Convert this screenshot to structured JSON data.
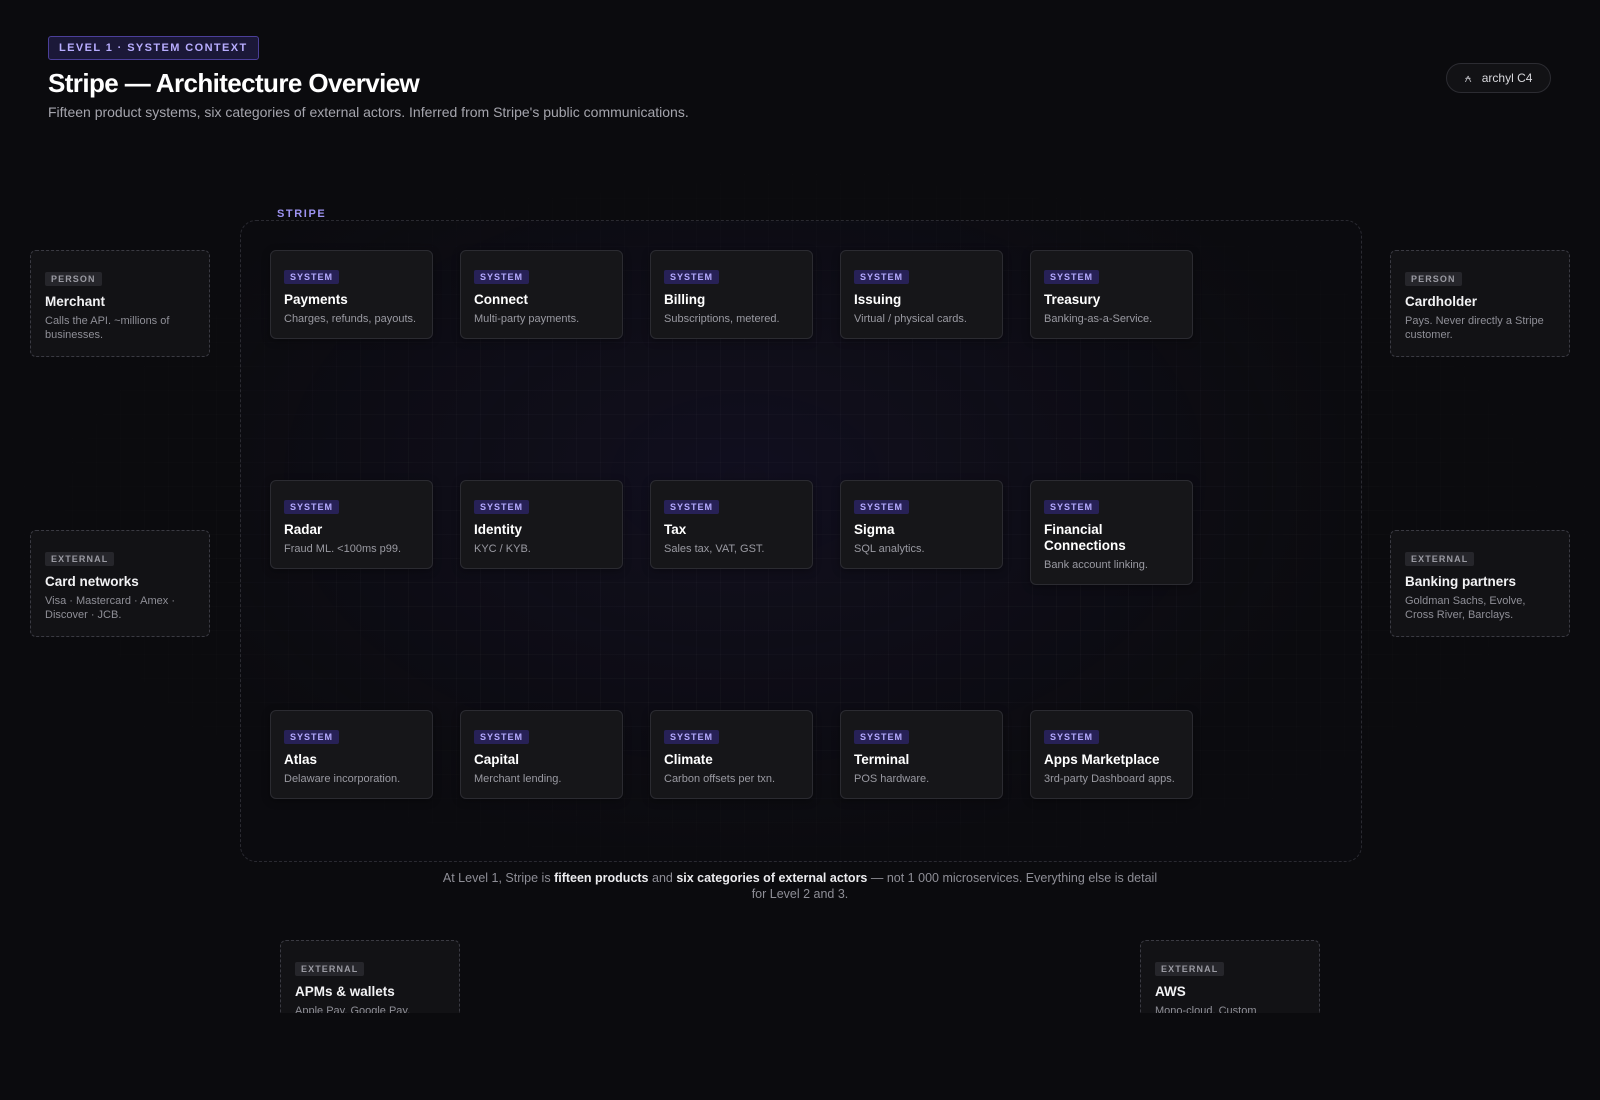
{
  "header": {
    "level_badge": "LEVEL 1 · SYSTEM CONTEXT",
    "title": "Stripe — Architecture Overview",
    "subtitle": "Fifteen product systems, six categories of external actors. Inferred from Stripe's public communications.",
    "brand": {
      "glyph": "⍲",
      "label": "archyl C4"
    }
  },
  "boundary": {
    "label": "STRIPE"
  },
  "systems": [
    {
      "tag": "SYSTEM",
      "name": "Payments",
      "desc": "Charges, refunds, payouts."
    },
    {
      "tag": "SYSTEM",
      "name": "Connect",
      "desc": "Multi-party payments."
    },
    {
      "tag": "SYSTEM",
      "name": "Billing",
      "desc": "Subscriptions, metered."
    },
    {
      "tag": "SYSTEM",
      "name": "Issuing",
      "desc": "Virtual / physical cards."
    },
    {
      "tag": "SYSTEM",
      "name": "Treasury",
      "desc": "Banking-as-a-Service."
    },
    {
      "tag": "SYSTEM",
      "name": "Radar",
      "desc": "Fraud ML. <100ms p99."
    },
    {
      "tag": "SYSTEM",
      "name": "Identity",
      "desc": "KYC / KYB."
    },
    {
      "tag": "SYSTEM",
      "name": "Tax",
      "desc": "Sales tax, VAT, GST."
    },
    {
      "tag": "SYSTEM",
      "name": "Sigma",
      "desc": "SQL analytics."
    },
    {
      "tag": "SYSTEM",
      "name": "Financial Connections",
      "desc": "Bank account linking."
    },
    {
      "tag": "SYSTEM",
      "name": "Atlas",
      "desc": "Delaware incorporation."
    },
    {
      "tag": "SYSTEM",
      "name": "Capital",
      "desc": "Merchant lending."
    },
    {
      "tag": "SYSTEM",
      "name": "Climate",
      "desc": "Carbon offsets per txn."
    },
    {
      "tag": "SYSTEM",
      "name": "Terminal",
      "desc": "POS hardware."
    },
    {
      "tag": "SYSTEM",
      "name": "Apps Marketplace",
      "desc": "3rd-party Dashboard apps."
    }
  ],
  "actors": [
    {
      "tag": "PERSON",
      "name": "Merchant",
      "desc": "Calls the API. ~millions of businesses."
    },
    {
      "tag": "PERSON",
      "name": "Cardholder",
      "desc": "Pays. Never directly a Stripe customer."
    },
    {
      "tag": "EXTERNAL",
      "name": "Card networks",
      "desc": "Visa · Mastercard · Amex · Discover · JCB."
    },
    {
      "tag": "EXTERNAL",
      "name": "Banking partners",
      "desc": "Goldman Sachs, Evolve, Cross River, Barclays."
    },
    {
      "tag": "EXTERNAL",
      "name": "APMs & wallets",
      "desc": "Apple Pay, Google Pay,"
    },
    {
      "tag": "EXTERNAL",
      "name": "AWS",
      "desc": "Mono-cloud. Custom"
    }
  ],
  "footnote": {
    "p1": "At Level 1, Stripe is ",
    "b1": "fifteen products",
    "p2": " and ",
    "b2": "six categories of external actors",
    "p3": " — not 1 000 microservices. Everything else is detail for Level 2 and 3."
  }
}
